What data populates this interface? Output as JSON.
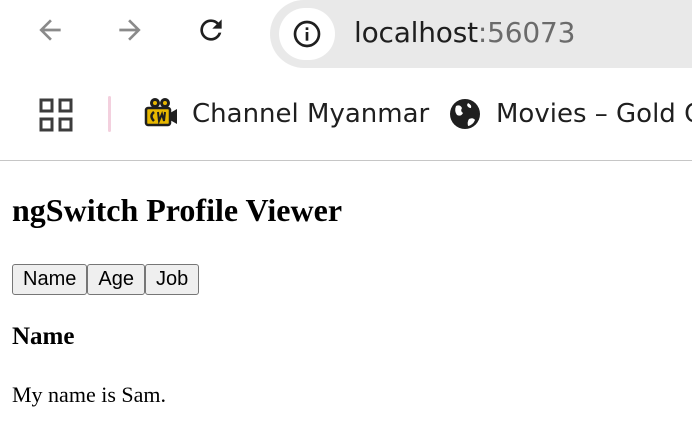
{
  "browser": {
    "nav": {
      "back_icon": "back-arrow-icon",
      "forward_icon": "forward-arrow-icon",
      "reload_icon": "reload-icon"
    },
    "omnibox": {
      "info_icon": "info-icon",
      "host": "localhost",
      "port": ":56073"
    },
    "bookmarks": {
      "apps_icon": "apps-grid-icon",
      "items": [
        {
          "label": "Channel Myanmar",
          "icon": "camera-logo-icon"
        },
        {
          "label": "Movies – Gold C",
          "icon": "globe-icon"
        }
      ]
    }
  },
  "page": {
    "title": "ngSwitch Profile Viewer",
    "buttons": [
      "Name",
      "Age",
      "Job"
    ],
    "section": {
      "title": "Name",
      "text": "My name is Sam."
    }
  },
  "colors": {
    "omnibox_bg": "#e9e9e9",
    "divider": "#f3d0de",
    "button_bg": "#efefef"
  }
}
